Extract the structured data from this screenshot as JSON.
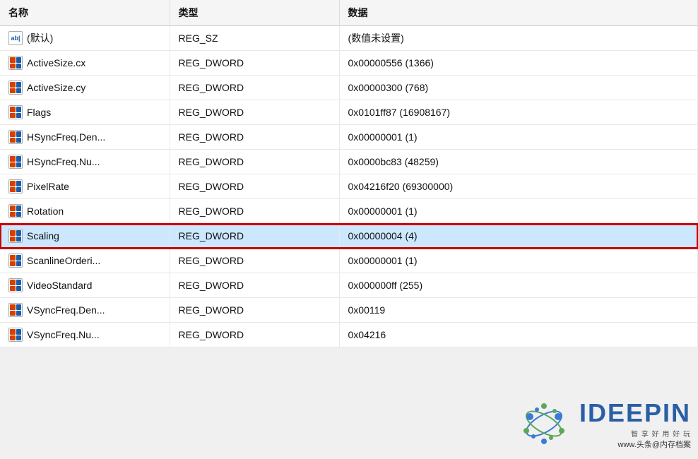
{
  "table": {
    "columns": [
      "名称",
      "类型",
      "数据"
    ],
    "rows": [
      {
        "icon": "ab",
        "name": "(默认)",
        "type": "REG_SZ",
        "data": "(数值未设置)",
        "highlighted": false
      },
      {
        "icon": "dword",
        "name": "ActiveSize.cx",
        "type": "REG_DWORD",
        "data": "0x00000556 (1366)",
        "highlighted": false
      },
      {
        "icon": "dword",
        "name": "ActiveSize.cy",
        "type": "REG_DWORD",
        "data": "0x00000300 (768)",
        "highlighted": false
      },
      {
        "icon": "dword",
        "name": "Flags",
        "type": "REG_DWORD",
        "data": "0x0101ff87 (16908167)",
        "highlighted": false
      },
      {
        "icon": "dword",
        "name": "HSyncFreq.Den...",
        "type": "REG_DWORD",
        "data": "0x00000001 (1)",
        "highlighted": false
      },
      {
        "icon": "dword",
        "name": "HSyncFreq.Nu...",
        "type": "REG_DWORD",
        "data": "0x0000bc83 (48259)",
        "highlighted": false
      },
      {
        "icon": "dword",
        "name": "PixelRate",
        "type": "REG_DWORD",
        "data": "0x04216f20 (69300000)",
        "highlighted": false
      },
      {
        "icon": "dword",
        "name": "Rotation",
        "type": "REG_DWORD",
        "data": "0x00000001 (1)",
        "highlighted": false
      },
      {
        "icon": "dword",
        "name": "Scaling",
        "type": "REG_DWORD",
        "data": "0x00000004 (4)",
        "highlighted": true
      },
      {
        "icon": "dword",
        "name": "ScanlineOrderi...",
        "type": "REG_DWORD",
        "data": "0x00000001 (1)",
        "highlighted": false
      },
      {
        "icon": "dword",
        "name": "VideoStandard",
        "type": "REG_DWORD",
        "data": "0x000000ff (255)",
        "highlighted": false
      },
      {
        "icon": "dword",
        "name": "VSyncFreq.Den...",
        "type": "REG_DWORD",
        "data": "0x00119",
        "highlighted": false
      },
      {
        "icon": "dword",
        "name": "VSyncFreq.Nu...",
        "type": "REG_DWORD",
        "data": "0x04216",
        "highlighted": false
      }
    ]
  },
  "watermark": {
    "brand": "IDEEPIN",
    "subtitle": "智 享 好 用 好 玩",
    "url": "www.头条@内存档案"
  }
}
